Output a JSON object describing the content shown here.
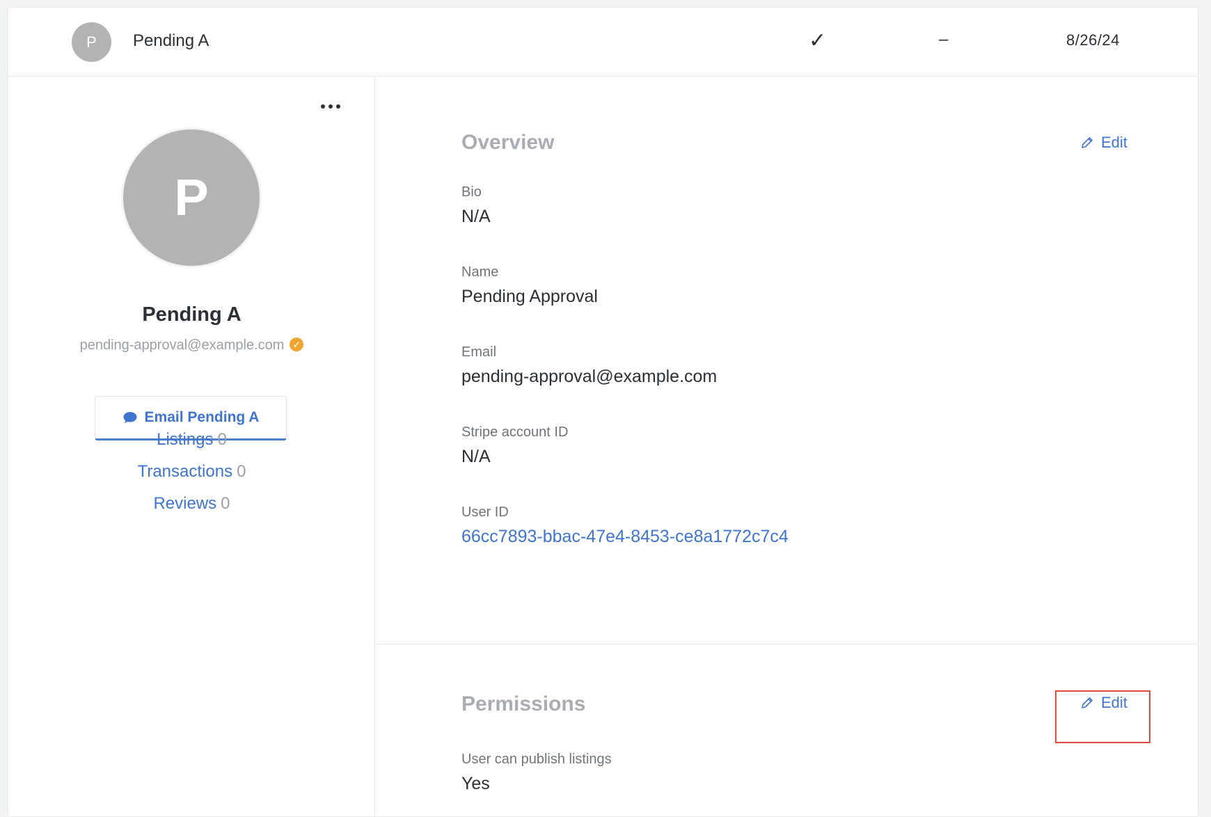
{
  "top_row": {
    "avatar_initial": "P",
    "name": "Pending A",
    "approved_mark": "✓",
    "dash": "–",
    "date": "8/26/24"
  },
  "profile": {
    "avatar_initial": "P",
    "name": "Pending A",
    "email": "pending-approval@example.com",
    "email_button_label": "Email Pending A",
    "stats": [
      {
        "label": "Listings",
        "count": "0"
      },
      {
        "label": "Transactions",
        "count": "0"
      },
      {
        "label": "Reviews",
        "count": "0"
      }
    ]
  },
  "overview": {
    "title": "Overview",
    "edit_label": "Edit",
    "fields": [
      {
        "label": "Bio",
        "value": "N/A"
      },
      {
        "label": "Name",
        "value": "Pending Approval"
      },
      {
        "label": "Email",
        "value": "pending-approval@example.com"
      },
      {
        "label": "Stripe account ID",
        "value": "N/A"
      },
      {
        "label": "User ID",
        "value": "66cc7893-bbac-47e4-8453-ce8a1772c7c4"
      }
    ]
  },
  "permissions": {
    "title": "Permissions",
    "edit_label": "Edit",
    "fields": [
      {
        "label": "User can publish listings",
        "value": "Yes"
      }
    ]
  },
  "colors": {
    "accent": "#3f74cf",
    "avatar": "#b3b3b3",
    "verified": "#f0a530",
    "highlight_box": "#e04a3a"
  }
}
